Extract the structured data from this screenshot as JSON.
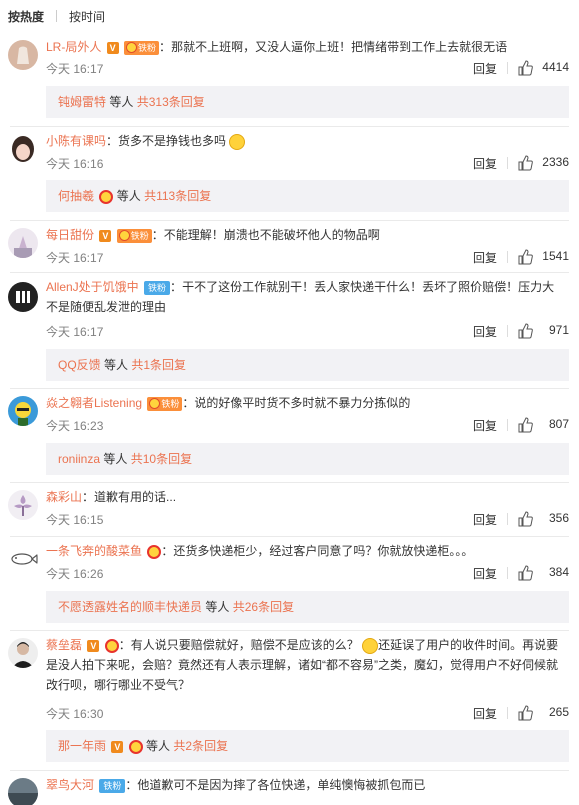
{
  "sort": {
    "hot": "按热度",
    "time": "按时间"
  },
  "labels": {
    "reply": "回复",
    "wait": "等人",
    "fan": "铁粉",
    "v": "V"
  },
  "comments": [
    {
      "user": "LR-局外人",
      "text": "那就不上班啊，又没人逼你上班！把情绪带到工作上去就很无语",
      "time": "今天 16:17",
      "likes": "4414",
      "sub_name": "钝姆雷特",
      "sub_count": "共313条回复"
    },
    {
      "user": "小陈有课吗",
      "text": "货多不是挣钱也多吗",
      "time": "今天 16:16",
      "likes": "2336",
      "sub_name": "何抽羲",
      "sub_count": "共113条回复"
    },
    {
      "user": "每日甜份",
      "text": "不能理解！崩溃也不能破坏他人的物品啊",
      "time": "今天 16:17",
      "likes": "1541"
    },
    {
      "user": "AllenJ处于饥饿中",
      "text": "干不了这份工作就别干！丢人家快递干什么！丢坏了照价赔偿！压力大不是随便乱发泄的理由",
      "time": "今天 16:17",
      "likes": "971",
      "sub_name": "QQ反馈",
      "sub_count": "共1条回复"
    },
    {
      "user": "焱之翱者Listening",
      "text": "说的好像平时货不多时就不暴力分拣似的",
      "time": "今天 16:23",
      "likes": "807",
      "sub_name": "roniinza",
      "sub_count": "共10条回复"
    },
    {
      "user": "森彩山",
      "text": "道歉有用的话...",
      "time": "今天 16:15",
      "likes": "356"
    },
    {
      "user": "一条飞奔的酸菜鱼",
      "text": "还货多快递柜少，经过客户同意了吗？你就放快递柜。。。",
      "time": "今天 16:26",
      "likes": "384",
      "sub_name": "不愿透露姓名的顺丰快递员",
      "sub_count": "共26条回复"
    },
    {
      "user": "蔡垒磊",
      "text": "有人说只要赔偿就好，赔偿不是应该的么？",
      "text2": "还延误了用户的收件时间。再说要是没人拍下来呢，会赔？竟然还有人表示理解，诸如“都不容易”之类，魔幻，觉得用户不好伺候就改行呗，哪行哪业不受气？",
      "time": "今天 16:30",
      "likes": "265",
      "sub_name": "那一年雨",
      "sub_count": "共2条回复"
    },
    {
      "user": "翠鸟大河",
      "text": "他道歉可不是因为摔了各位快递，单纯懊悔被抓包而已"
    }
  ]
}
